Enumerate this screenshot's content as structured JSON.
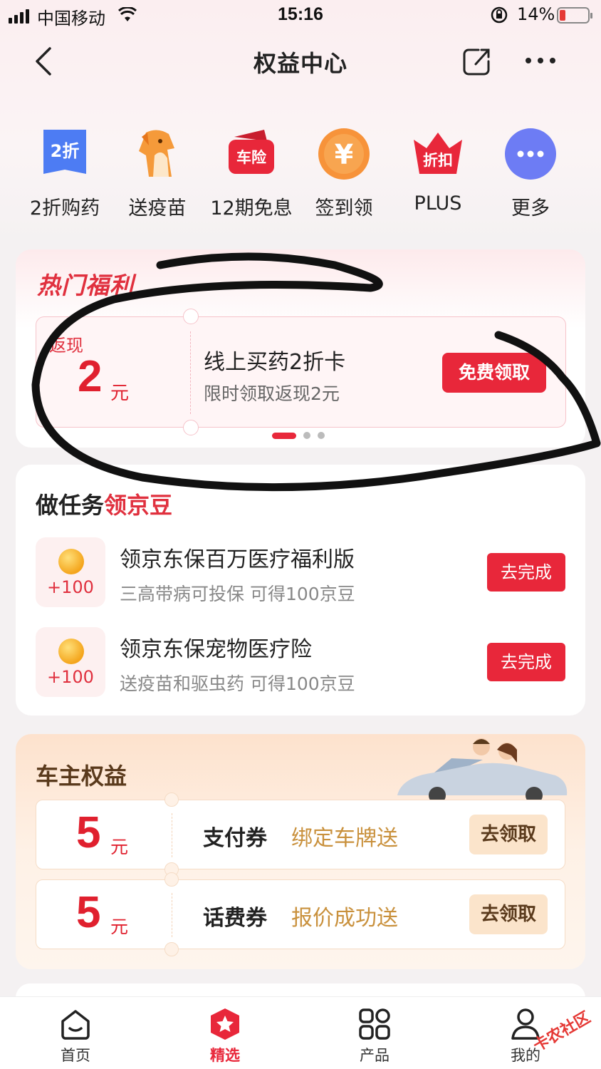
{
  "status_bar": {
    "carrier": "中国移动",
    "time": "15:16",
    "battery": "14%"
  },
  "nav": {
    "title": "权益中心"
  },
  "quick_actions": [
    {
      "icon": "2折",
      "label": "2折购药"
    },
    {
      "icon": "dog-icon",
      "label": "送疫苗"
    },
    {
      "icon": "车险",
      "label": "12期免息"
    },
    {
      "icon": "¥",
      "label": "签到领"
    },
    {
      "icon": "折扣",
      "label": "PLUS"
    },
    {
      "icon": "more-icon",
      "label": "更多"
    }
  ],
  "hot": {
    "title": "热门福利",
    "coupon": {
      "tag": "返现",
      "amount": "2",
      "unit": "元",
      "name": "线上买药2折卡",
      "desc": "限时领取返现2元",
      "button": "免费领取"
    },
    "pager": {
      "active": 1,
      "total": 3
    }
  },
  "tasks": {
    "title_a": "做任务",
    "title_b": "领京豆",
    "items": [
      {
        "points": "+100",
        "name": "领京东保百万医疗福利版",
        "desc": "三高带病可投保 可得100京豆",
        "button": "去完成"
      },
      {
        "points": "+100",
        "name": "领京东保宠物医疗险",
        "desc": "送疫苗和驱虫药 可得100京豆",
        "button": "去完成"
      }
    ]
  },
  "car": {
    "title": "车主权益",
    "items": [
      {
        "amount": "5",
        "unit": "元",
        "name": "支付券",
        "desc": "绑定车牌送",
        "button": "去领取"
      },
      {
        "amount": "5",
        "unit": "元",
        "name": "话费券",
        "desc": "报价成功送",
        "button": "去领取"
      }
    ]
  },
  "tabbar": [
    {
      "label": "首页",
      "icon": "home-icon"
    },
    {
      "label": "精选",
      "icon": "star-badge-icon",
      "active": true
    },
    {
      "label": "产品",
      "icon": "grid-icon"
    },
    {
      "label": "我的",
      "icon": "user-icon"
    }
  ],
  "watermark": "卡农社区",
  "colors": {
    "primary": "#e8273a",
    "gold": "#c9913d",
    "car_bg": "#fde2cd"
  }
}
